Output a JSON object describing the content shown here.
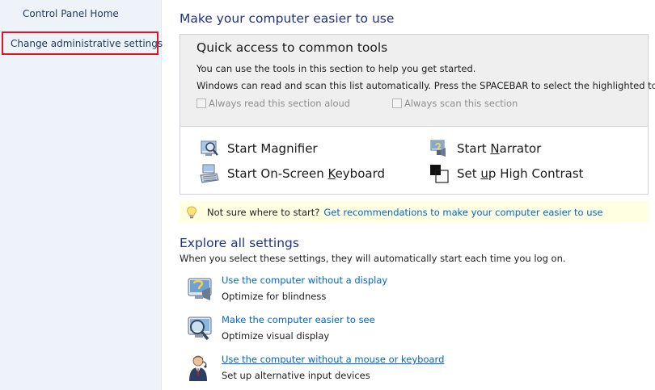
{
  "sidebar": {
    "home_link": "Control Panel Home",
    "admin_link": "Change administrative settings",
    "highlight_color": "#e81123",
    "background": "#eef3fa"
  },
  "main": {
    "title": "Make your computer easier to use",
    "quick_access": {
      "title": "Quick access to common tools",
      "line1": "You can use the tools in this section to help you get started.",
      "line2": "Windows can read and scan this list automatically.  Press the SPACEBAR to select the highlighted tool.",
      "checkbox_read": "Always read this section aloud",
      "checkbox_scan": "Always scan this section",
      "checkbox_read_checked": false,
      "checkbox_scan_checked": false,
      "tools": [
        {
          "label": "Start Magnifier",
          "icon": "magnifier-icon"
        },
        {
          "label": "Start Narrator",
          "icon": "narrator-icon"
        },
        {
          "label": "Start On-Screen Keyboard",
          "icon": "keyboard-icon"
        },
        {
          "label": "Set up High Contrast",
          "icon": "high-contrast-icon"
        }
      ]
    },
    "tip": {
      "question": "Not sure where to start?",
      "link": "Get recommendations to make your computer easier to use",
      "background": "#ffffe1"
    },
    "explore": {
      "title": "Explore all settings",
      "subtitle": "When you select these settings, they will automatically start each time you log on.",
      "options": [
        {
          "title": "Use the computer without a display",
          "desc": "Optimize for blindness",
          "icon": "display-icon"
        },
        {
          "title": "Make the computer easier to see",
          "desc": "Optimize visual display",
          "icon": "magnify-display-icon"
        },
        {
          "title": "Use the computer without a mouse or keyboard",
          "desc": "Set up alternative input devices",
          "icon": "speech-user-icon"
        }
      ]
    },
    "link_color": "#0066cc",
    "heading_color": "#1e3287"
  }
}
